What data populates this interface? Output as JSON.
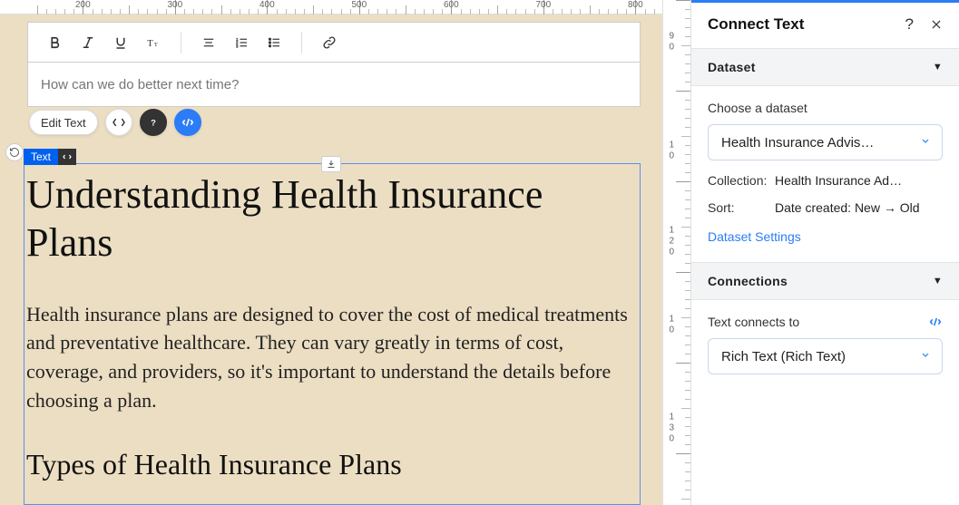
{
  "ruler_h": [
    200,
    300,
    400,
    500,
    600,
    700,
    800
  ],
  "ruler_v_labels": [
    "9",
    "0",
    "1",
    "0",
    "1",
    "2",
    "0",
    "1",
    "0",
    "1",
    "3",
    "0"
  ],
  "toolbar": {
    "prompt_placeholder": "How can we do better next time?",
    "edit_text_label": "Edit Text"
  },
  "selection": {
    "chip_label": "Text",
    "heading": "Understanding Health Insurance Plans",
    "body": "Health insurance plans are designed to cover the cost of medical treatments and preventative healthcare. They can vary greatly in terms of cost, coverage, and providers, so it's important to understand the details before choosing a plan.",
    "subheading": "Types of Health Insurance Plans"
  },
  "panel": {
    "title": "Connect Text",
    "dataset": {
      "header": "Dataset",
      "choose_label": "Choose a dataset",
      "selected": "Health Insurance Advis…",
      "collection_label": "Collection:",
      "collection_value": "Health Insurance Ad…",
      "sort_label": "Sort:",
      "sort_value": "Date created: New → Old",
      "settings_link": "Dataset Settings"
    },
    "connections": {
      "header": "Connections",
      "connects_label": "Text connects to",
      "selected": "Rich Text (Rich Text)"
    }
  }
}
